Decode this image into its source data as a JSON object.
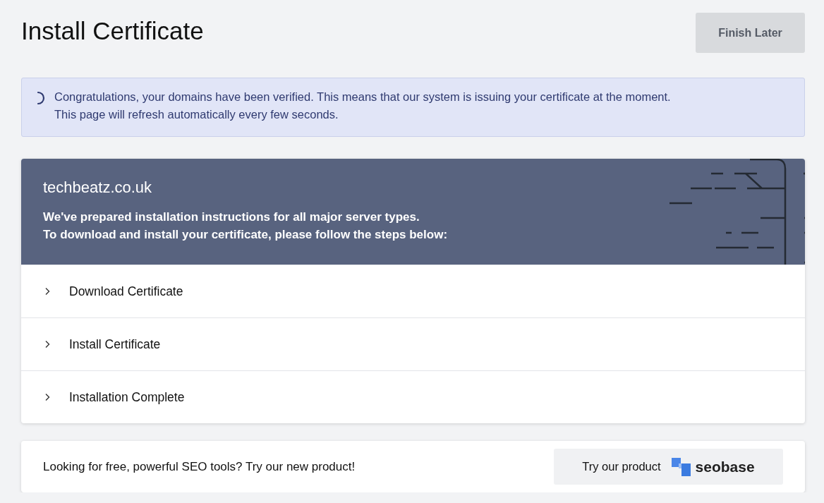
{
  "page_title": "Install Certificate",
  "finish_button": "Finish Later",
  "notice": {
    "lines": [
      "Congratulations, your domains have been verified. This means that our system is issuing your certificate at the moment.",
      "This page will refresh automatically every few seconds."
    ]
  },
  "certificate_card": {
    "domain": "techbeatz.co.uk",
    "intro_lines": [
      "We've prepared installation instructions for all major server types.",
      "To download and install your certificate, please follow the steps below:"
    ],
    "steps": [
      {
        "label": "Download Certificate",
        "expanded": false
      },
      {
        "label": "Install Certificate",
        "expanded": false
      },
      {
        "label": "Installation Complete",
        "expanded": false
      }
    ]
  },
  "promo": {
    "text": "Looking for free, powerful SEO tools? Try our new product!",
    "button_label": "Try our product",
    "brand": "seobase"
  }
}
